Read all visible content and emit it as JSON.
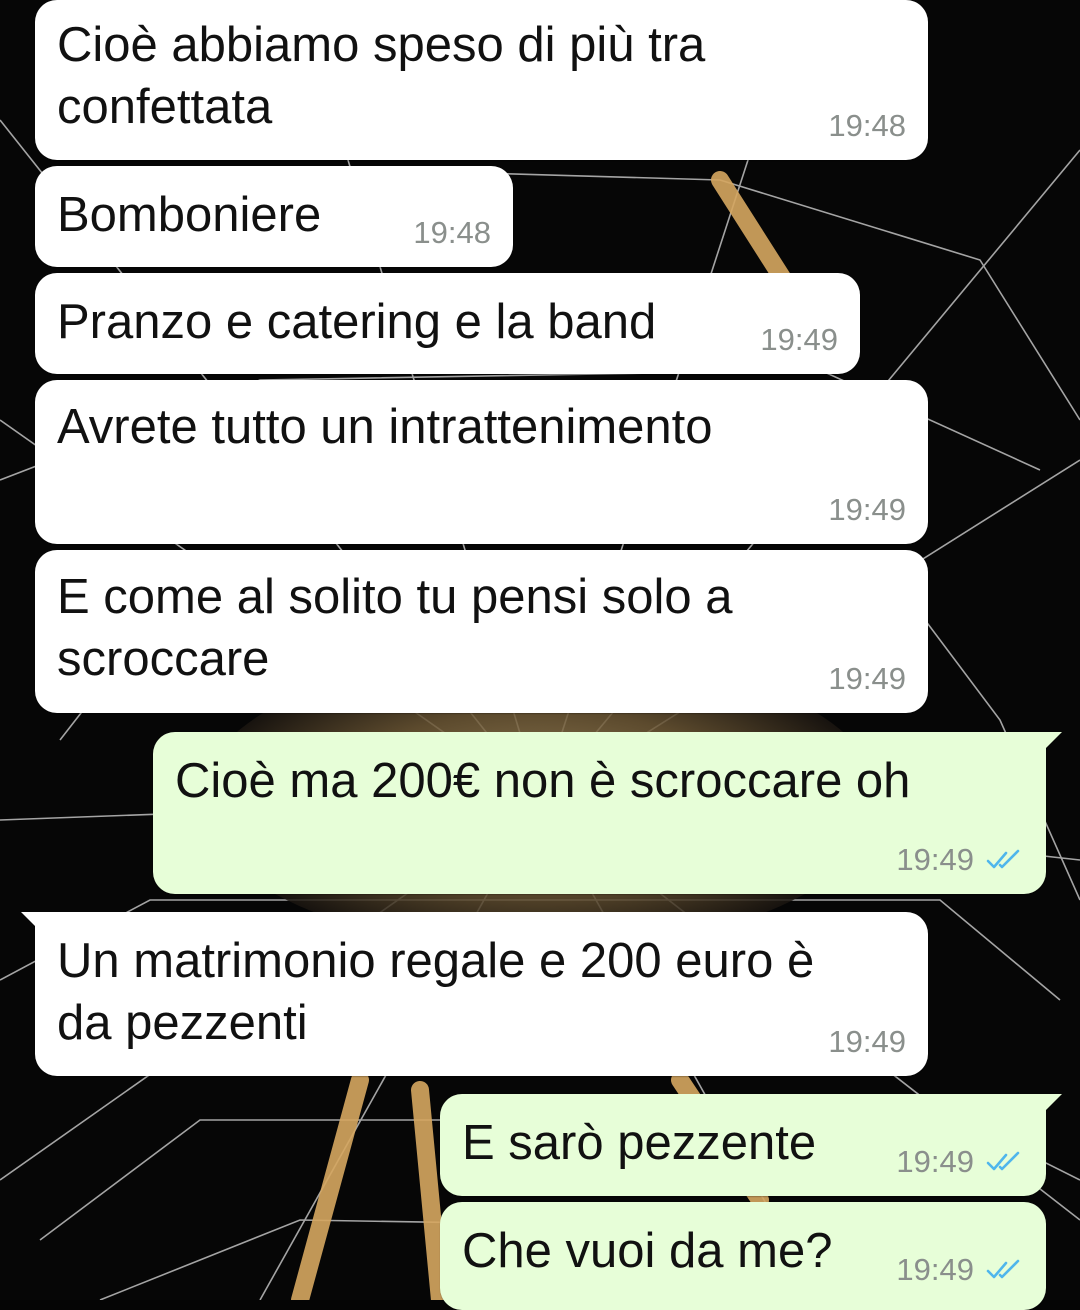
{
  "theme": {
    "incoming_bubble": "#ffffff",
    "outgoing_bubble": "#e7fed8",
    "read_ticks_color": "#4fb6ec",
    "wallpaper": "spider-web-photo"
  },
  "messages": [
    {
      "direction": "incoming",
      "text": "Cioè abbiamo speso di più tra\nconfettata",
      "time": "19:48"
    },
    {
      "direction": "incoming",
      "text": "Bomboniere",
      "time": "19:48"
    },
    {
      "direction": "incoming",
      "text": "Pranzo e catering e la band",
      "time": "19:49"
    },
    {
      "direction": "incoming",
      "text": "Avrete tutto un intrattenimento",
      "time": "19:49"
    },
    {
      "direction": "incoming",
      "text": "E come al solito tu pensi solo a\nscroccare",
      "time": "19:49"
    },
    {
      "direction": "outgoing",
      "text": "Cioè ma 200€ non è scroccare oh",
      "time": "19:49",
      "status": "read"
    },
    {
      "direction": "incoming",
      "text": "Un matrimonio regale e 200 euro è\nda pezzenti",
      "time": "19:49"
    },
    {
      "direction": "outgoing",
      "text": "E sarò pezzente",
      "time": "19:49",
      "status": "read"
    },
    {
      "direction": "outgoing",
      "text": "Che vuoi da me?",
      "time": "19:49",
      "status": "read"
    }
  ]
}
